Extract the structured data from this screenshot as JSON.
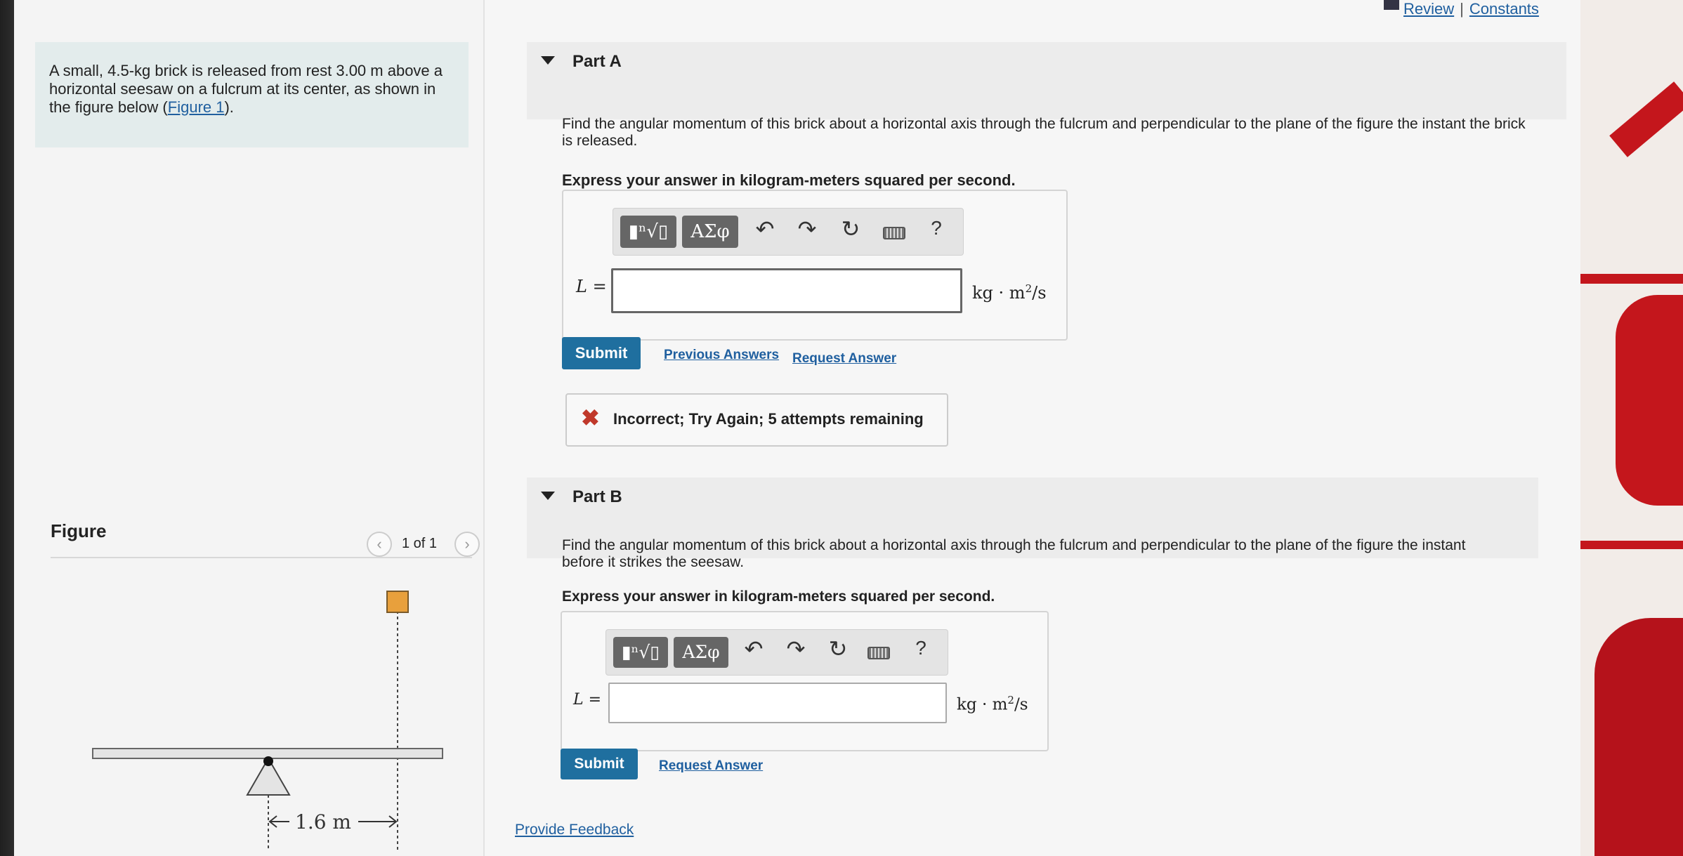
{
  "problem": {
    "text_before_link": "A small, 4.5-kg brick is released from rest 3.00 m above a horizontal seesaw on a fulcrum at its center, as shown in the figure below (",
    "link": "Figure 1",
    "text_after_link": ")."
  },
  "figure": {
    "title": "Figure",
    "count": "1 of 1",
    "prev_icon": "chevron-left-icon",
    "next_icon": "chevron-right-icon",
    "dimension_label": "1.6 m",
    "brick_color": "#e8a03c",
    "seesaw_color": "#e4e4e4"
  },
  "top_links": {
    "review": "Review",
    "separator": "|",
    "constants": "Constants"
  },
  "toolbar": {
    "template_button": "▮ⁿ√▯",
    "greek_button": "ΑΣφ",
    "undo_icon": "↶",
    "redo_icon": "↷",
    "reset_icon": "↻",
    "keyboard_icon": "keyboard-icon",
    "help": "?"
  },
  "partA": {
    "title": "Part A",
    "question": "Find the angular momentum of this brick about a horizontal axis through the fulcrum and perpendicular to the plane of the figure the instant the brick is released.",
    "express": "Express your answer in kilogram-meters squared per second.",
    "label": "L =",
    "value": "",
    "unit_main": "kg · m",
    "unit_exp": "2",
    "unit_tail": "/s",
    "submit": "Submit",
    "previous_answers": "Previous Answers",
    "request_answer": "Request Answer",
    "feedback_icon": "✖",
    "feedback": "Incorrect; Try Again; 5 attempts remaining"
  },
  "partB": {
    "title": "Part B",
    "question": "Find the angular momentum of this brick about a horizontal axis through the fulcrum and perpendicular to the plane of the figure the instant before it strikes the seesaw.",
    "express": "Express your answer in kilogram-meters squared per second.",
    "label": "L =",
    "value": "",
    "unit_main": "kg · m",
    "unit_exp": "2",
    "unit_tail": "/s",
    "submit": "Submit",
    "request_answer": "Request Answer"
  },
  "footer": {
    "provide_feedback": "Provide Feedback"
  },
  "colors": {
    "accent": "#1f6f9f",
    "link": "#1f5f9f",
    "error": "#c0392b"
  }
}
